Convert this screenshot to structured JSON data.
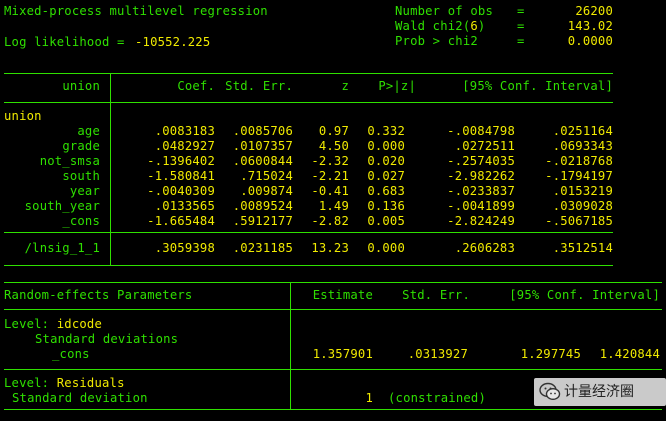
{
  "header": {
    "title": "Mixed-process multilevel regression",
    "loglik_label": "Log likelihood =",
    "loglik_value": "-10552.225",
    "nobs_label": "Number of obs",
    "nobs_value": "26200",
    "wald_label_prefix": "Wald chi2(",
    "wald_df": "6",
    "wald_label_suffix": ")",
    "wald_value": "143.02",
    "prob_label": "Prob > chi2",
    "prob_value": "0.0000",
    "eq_sign": "="
  },
  "coef_table": {
    "columns": [
      "union",
      "Coef.",
      "Std. Err.",
      "z",
      "P>|z|",
      "[95% Conf. Interval]"
    ],
    "equation": "union",
    "rows": [
      {
        "name": "age",
        "coef": ".0083183",
        "se": ".0085706",
        "z": "0.97",
        "p": "0.332",
        "lo": "-.0084798",
        "hi": ".0251164"
      },
      {
        "name": "grade",
        "coef": ".0482927",
        "se": ".0107357",
        "z": "4.50",
        "p": "0.000",
        "lo": ".0272511",
        "hi": ".0693343"
      },
      {
        "name": "not_smsa",
        "coef": "-.1396402",
        "se": ".0600844",
        "z": "-2.32",
        "p": "0.020",
        "lo": "-.2574035",
        "hi": "-.0218768"
      },
      {
        "name": "south",
        "coef": "-1.580841",
        "se": ".715024",
        "z": "-2.21",
        "p": "0.027",
        "lo": "-2.982262",
        "hi": "-.1794197"
      },
      {
        "name": "year",
        "coef": "-.0040309",
        "se": ".009874",
        "z": "-0.41",
        "p": "0.683",
        "lo": "-.0233837",
        "hi": ".0153219"
      },
      {
        "name": "south_year",
        "coef": ".0133565",
        "se": ".0089524",
        "z": "1.49",
        "p": "0.136",
        "lo": "-.0041899",
        "hi": ".0309028"
      },
      {
        "name": "_cons",
        "coef": "-1.665484",
        "se": ".5912177",
        "z": "-2.82",
        "p": "0.005",
        "lo": "-2.824249",
        "hi": "-.5067185"
      }
    ],
    "lnsig": {
      "name": "/lnsig_1_1",
      "coef": ".3059398",
      "se": ".0231185",
      "z": "13.23",
      "p": "0.000",
      "lo": ".2606283",
      "hi": ".3512514"
    }
  },
  "re_table": {
    "header_left": "Random-effects Parameters",
    "header_estimate": "Estimate",
    "header_se": "Std. Err.",
    "header_ci": "[95% Conf. Interval]",
    "level1_prefix": "Level: ",
    "level1_name": "idcode",
    "level1_sub": "Standard deviations",
    "cons_label": "_cons",
    "cons_estimate": "1.357901",
    "cons_se": ".0313927",
    "cons_lo": "1.297745",
    "cons_hi": "1.420844",
    "level2_prefix": "Level: ",
    "level2_name": "Residuals",
    "level2_sub": "Standard deviation",
    "resid_estimate": "1",
    "resid_note": "(constrained)"
  },
  "watermark": {
    "text": "计量经济圈",
    "icon": "wechat-icon"
  },
  "colors": {
    "background": "#000000",
    "text": "#2fe000",
    "emphasis": "#f0ea00"
  }
}
